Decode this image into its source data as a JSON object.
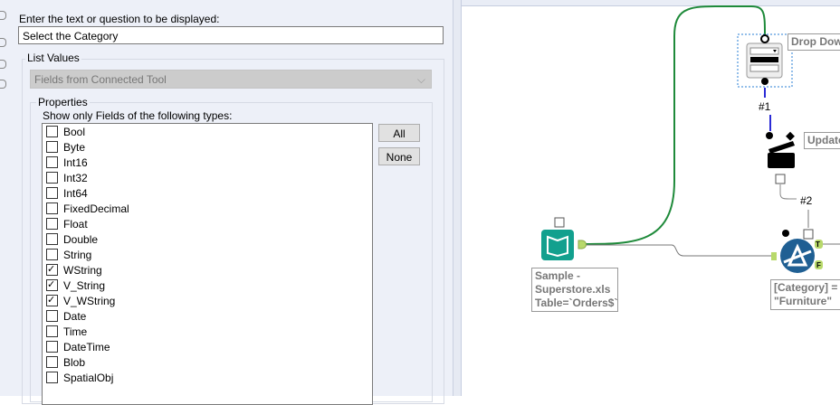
{
  "config": {
    "prompt_label": "Enter the text or question to be displayed:",
    "prompt_value": "Select the Category",
    "list_values_label": "List Values",
    "list_source": "Fields from Connected Tool",
    "properties_label": "Properties",
    "types_label": "Show only Fields of the following types:",
    "all_button": "All",
    "none_button": "None",
    "types": [
      {
        "label": "Bool",
        "checked": false
      },
      {
        "label": "Byte",
        "checked": false
      },
      {
        "label": "Int16",
        "checked": false
      },
      {
        "label": "Int32",
        "checked": false
      },
      {
        "label": "Int64",
        "checked": false
      },
      {
        "label": "FixedDecimal",
        "checked": false
      },
      {
        "label": "Float",
        "checked": false
      },
      {
        "label": "Double",
        "checked": false
      },
      {
        "label": "String",
        "checked": false
      },
      {
        "label": "WString",
        "checked": true
      },
      {
        "label": "V_String",
        "checked": true
      },
      {
        "label": "V_WString",
        "checked": true
      },
      {
        "label": "Date",
        "checked": false
      },
      {
        "label": "Time",
        "checked": false
      },
      {
        "label": "DateTime",
        "checked": false
      },
      {
        "label": "Blob",
        "checked": false
      },
      {
        "label": "SpatialObj",
        "checked": false
      }
    ]
  },
  "canvas": {
    "dropdown_note": "Drop Down",
    "update_note": "Update",
    "conn1": "#1",
    "conn2": "#2",
    "input_note": [
      "Sample -",
      "Superstore.xls",
      "Table=`Orders$`"
    ],
    "filter_note": [
      "[Category] =",
      "\"Furniture\""
    ],
    "filter_true": "T",
    "filter_false": "F",
    "colors": {
      "green": "#1e8a3a",
      "blue": "#2b2bd6",
      "teal": "#12a08e",
      "filter": "#1f5f93",
      "anchor": "#b8d96b"
    }
  }
}
